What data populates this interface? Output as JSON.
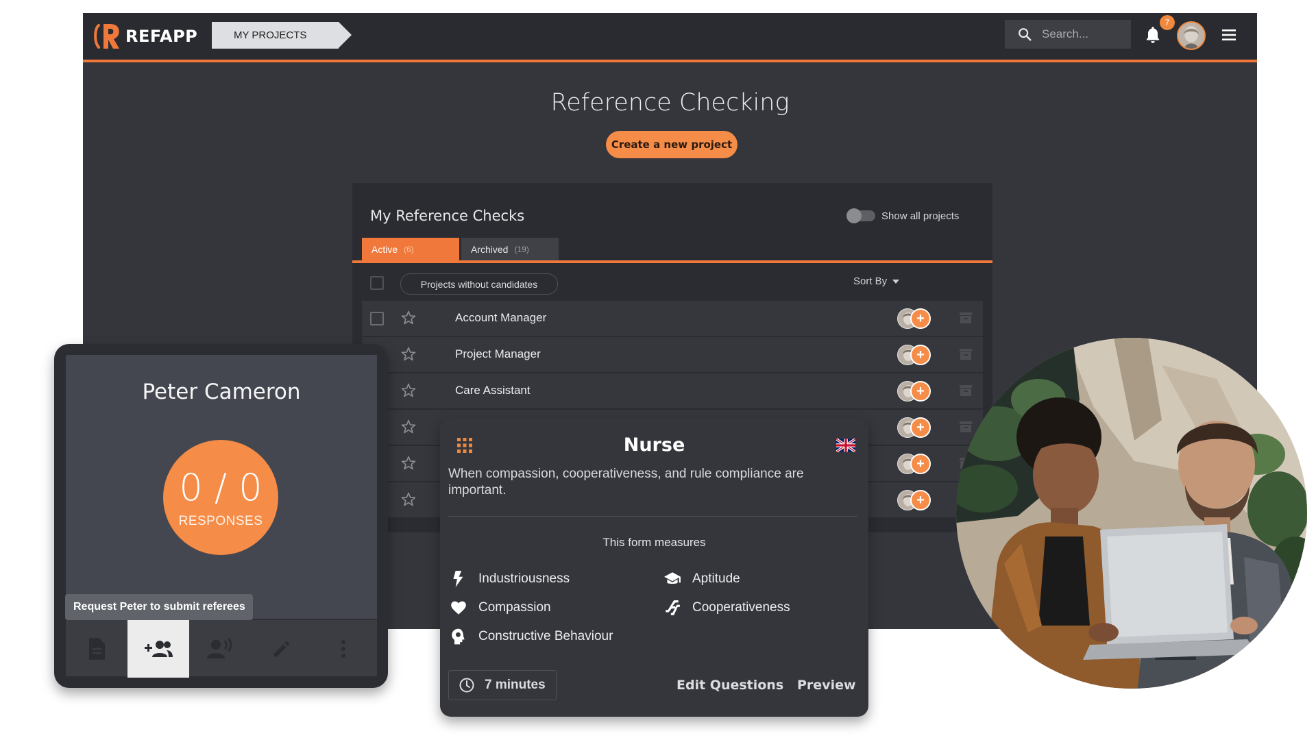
{
  "header": {
    "logo_text": "REFAPP",
    "breadcrumb": "MY PROJECTS",
    "search_placeholder": "Search...",
    "notification_count": "7"
  },
  "main": {
    "title": "Reference Checking",
    "create_button": "Create a new project"
  },
  "panel": {
    "title": "My Reference Checks",
    "toggle_label": "Show all projects",
    "tabs": [
      {
        "label": "Active",
        "count": "(6)"
      },
      {
        "label": "Archived",
        "count": "(19)"
      }
    ],
    "filter_chip": "Projects without candidates",
    "sort_label": "Sort By",
    "rows": [
      {
        "label": "Account Manager"
      },
      {
        "label": "Project Manager"
      },
      {
        "label": "Care Assistant"
      },
      {
        "label": ""
      },
      {
        "label": ""
      },
      {
        "label": ""
      }
    ]
  },
  "candidate": {
    "name": "Peter Cameron",
    "responses_value": "0 / 0",
    "responses_label": "RESPONSES",
    "tooltip": "Request Peter to submit referees"
  },
  "form_card": {
    "title": "Nurse",
    "description": "When compassion, cooperativeness, and rule compliance are important.",
    "measures_heading": "This form measures",
    "traits": [
      "Industriousness",
      "Aptitude",
      "Compassion",
      "Cooperativeness",
      "Constructive Behaviour"
    ],
    "duration": "7 minutes",
    "edit_label": "Edit Questions",
    "preview_label": "Preview"
  },
  "colors": {
    "accent": "#f0783b",
    "button": "#f58c47",
    "bg_dark": "#34363c",
    "bar_dark": "#2a2b30"
  }
}
